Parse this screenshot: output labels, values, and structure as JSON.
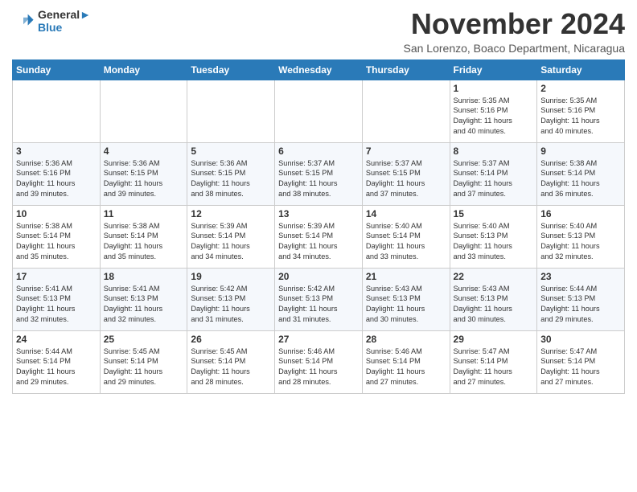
{
  "header": {
    "logo_line1": "General",
    "logo_line2": "Blue",
    "month_title": "November 2024",
    "location": "San Lorenzo, Boaco Department, Nicaragua"
  },
  "weekdays": [
    "Sunday",
    "Monday",
    "Tuesday",
    "Wednesday",
    "Thursday",
    "Friday",
    "Saturday"
  ],
  "weeks": [
    [
      {
        "day": "",
        "info": ""
      },
      {
        "day": "",
        "info": ""
      },
      {
        "day": "",
        "info": ""
      },
      {
        "day": "",
        "info": ""
      },
      {
        "day": "",
        "info": ""
      },
      {
        "day": "1",
        "info": "Sunrise: 5:35 AM\nSunset: 5:16 PM\nDaylight: 11 hours\nand 40 minutes."
      },
      {
        "day": "2",
        "info": "Sunrise: 5:35 AM\nSunset: 5:16 PM\nDaylight: 11 hours\nand 40 minutes."
      }
    ],
    [
      {
        "day": "3",
        "info": "Sunrise: 5:36 AM\nSunset: 5:16 PM\nDaylight: 11 hours\nand 39 minutes."
      },
      {
        "day": "4",
        "info": "Sunrise: 5:36 AM\nSunset: 5:15 PM\nDaylight: 11 hours\nand 39 minutes."
      },
      {
        "day": "5",
        "info": "Sunrise: 5:36 AM\nSunset: 5:15 PM\nDaylight: 11 hours\nand 38 minutes."
      },
      {
        "day": "6",
        "info": "Sunrise: 5:37 AM\nSunset: 5:15 PM\nDaylight: 11 hours\nand 38 minutes."
      },
      {
        "day": "7",
        "info": "Sunrise: 5:37 AM\nSunset: 5:15 PM\nDaylight: 11 hours\nand 37 minutes."
      },
      {
        "day": "8",
        "info": "Sunrise: 5:37 AM\nSunset: 5:14 PM\nDaylight: 11 hours\nand 37 minutes."
      },
      {
        "day": "9",
        "info": "Sunrise: 5:38 AM\nSunset: 5:14 PM\nDaylight: 11 hours\nand 36 minutes."
      }
    ],
    [
      {
        "day": "10",
        "info": "Sunrise: 5:38 AM\nSunset: 5:14 PM\nDaylight: 11 hours\nand 35 minutes."
      },
      {
        "day": "11",
        "info": "Sunrise: 5:38 AM\nSunset: 5:14 PM\nDaylight: 11 hours\nand 35 minutes."
      },
      {
        "day": "12",
        "info": "Sunrise: 5:39 AM\nSunset: 5:14 PM\nDaylight: 11 hours\nand 34 minutes."
      },
      {
        "day": "13",
        "info": "Sunrise: 5:39 AM\nSunset: 5:14 PM\nDaylight: 11 hours\nand 34 minutes."
      },
      {
        "day": "14",
        "info": "Sunrise: 5:40 AM\nSunset: 5:14 PM\nDaylight: 11 hours\nand 33 minutes."
      },
      {
        "day": "15",
        "info": "Sunrise: 5:40 AM\nSunset: 5:13 PM\nDaylight: 11 hours\nand 33 minutes."
      },
      {
        "day": "16",
        "info": "Sunrise: 5:40 AM\nSunset: 5:13 PM\nDaylight: 11 hours\nand 32 minutes."
      }
    ],
    [
      {
        "day": "17",
        "info": "Sunrise: 5:41 AM\nSunset: 5:13 PM\nDaylight: 11 hours\nand 32 minutes."
      },
      {
        "day": "18",
        "info": "Sunrise: 5:41 AM\nSunset: 5:13 PM\nDaylight: 11 hours\nand 32 minutes."
      },
      {
        "day": "19",
        "info": "Sunrise: 5:42 AM\nSunset: 5:13 PM\nDaylight: 11 hours\nand 31 minutes."
      },
      {
        "day": "20",
        "info": "Sunrise: 5:42 AM\nSunset: 5:13 PM\nDaylight: 11 hours\nand 31 minutes."
      },
      {
        "day": "21",
        "info": "Sunrise: 5:43 AM\nSunset: 5:13 PM\nDaylight: 11 hours\nand 30 minutes."
      },
      {
        "day": "22",
        "info": "Sunrise: 5:43 AM\nSunset: 5:13 PM\nDaylight: 11 hours\nand 30 minutes."
      },
      {
        "day": "23",
        "info": "Sunrise: 5:44 AM\nSunset: 5:13 PM\nDaylight: 11 hours\nand 29 minutes."
      }
    ],
    [
      {
        "day": "24",
        "info": "Sunrise: 5:44 AM\nSunset: 5:14 PM\nDaylight: 11 hours\nand 29 minutes."
      },
      {
        "day": "25",
        "info": "Sunrise: 5:45 AM\nSunset: 5:14 PM\nDaylight: 11 hours\nand 29 minutes."
      },
      {
        "day": "26",
        "info": "Sunrise: 5:45 AM\nSunset: 5:14 PM\nDaylight: 11 hours\nand 28 minutes."
      },
      {
        "day": "27",
        "info": "Sunrise: 5:46 AM\nSunset: 5:14 PM\nDaylight: 11 hours\nand 28 minutes."
      },
      {
        "day": "28",
        "info": "Sunrise: 5:46 AM\nSunset: 5:14 PM\nDaylight: 11 hours\nand 27 minutes."
      },
      {
        "day": "29",
        "info": "Sunrise: 5:47 AM\nSunset: 5:14 PM\nDaylight: 11 hours\nand 27 minutes."
      },
      {
        "day": "30",
        "info": "Sunrise: 5:47 AM\nSunset: 5:14 PM\nDaylight: 11 hours\nand 27 minutes."
      }
    ]
  ]
}
